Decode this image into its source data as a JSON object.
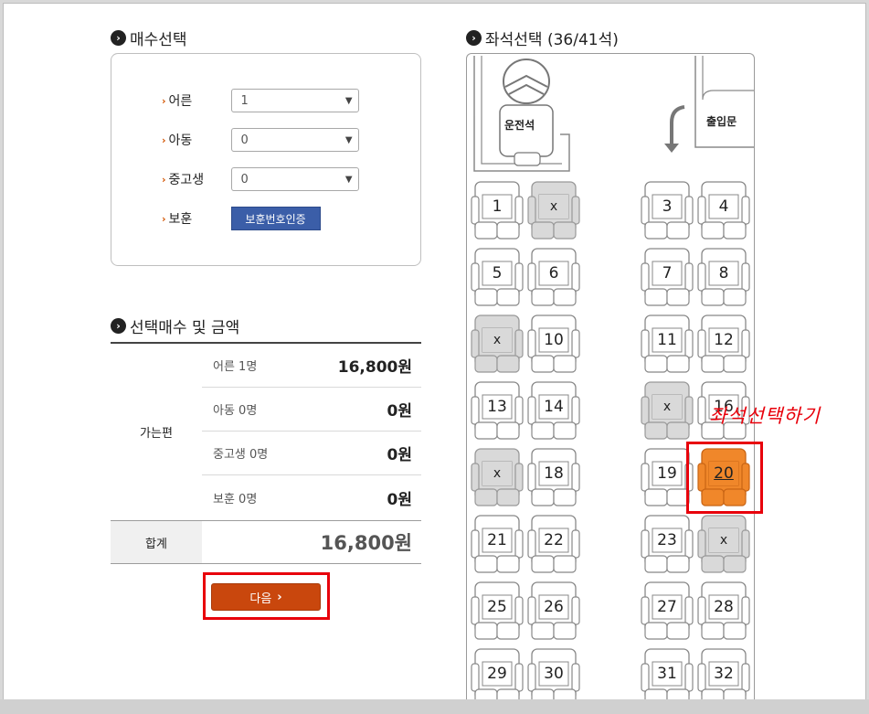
{
  "quantity": {
    "title": "매수선택",
    "rows": [
      {
        "label": "어른",
        "value": "1"
      },
      {
        "label": "아동",
        "value": "0"
      },
      {
        "label": "중고생",
        "value": "0"
      },
      {
        "label": "보훈",
        "button": "보훈번호인증"
      }
    ]
  },
  "summary": {
    "title": "선택매수 및 금액",
    "direction": "가는편",
    "rows": [
      {
        "label": "어른 1명",
        "amount": "16,800원"
      },
      {
        "label": "아동 0명",
        "amount": "0원"
      },
      {
        "label": "중고생 0명",
        "amount": "0원"
      },
      {
        "label": "보훈 0명",
        "amount": "0원"
      }
    ],
    "total_label": "합계",
    "total_amount": "16,800원",
    "next_label": "다음"
  },
  "seats": {
    "title": "좌석선택 (36/41석)",
    "driver_label": "운전석",
    "door_label": "출입문",
    "annotation": "좌석선택하기",
    "taken_mark": "x",
    "colors": {
      "selected": "#f0872a",
      "taken": "#d9d9d9",
      "highlight": "#e8000b"
    },
    "rows": [
      [
        "1",
        "x",
        "3",
        "4"
      ],
      [
        "5",
        "6",
        "7",
        "8"
      ],
      [
        "x",
        "10",
        "11",
        "12"
      ],
      [
        "13",
        "14",
        "x",
        "16"
      ],
      [
        "x",
        "18",
        "19",
        "20"
      ],
      [
        "21",
        "22",
        "23",
        "x"
      ],
      [
        "25",
        "26",
        "27",
        "28"
      ],
      [
        "29",
        "30",
        "31",
        "32"
      ]
    ],
    "selected": "20"
  }
}
